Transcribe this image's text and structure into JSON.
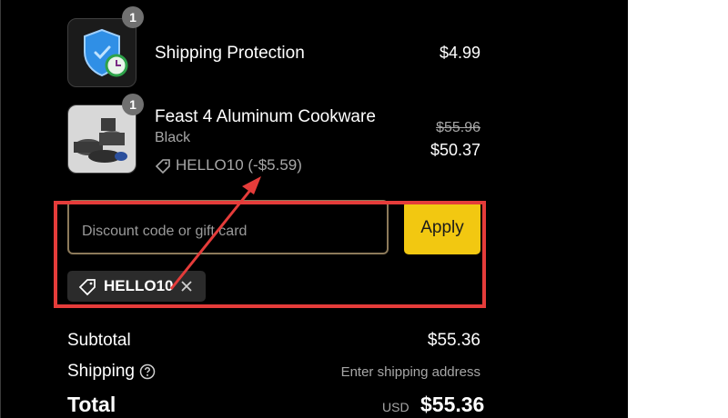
{
  "items": [
    {
      "quantity": "1",
      "name": "Shipping Protection",
      "price": "$4.99",
      "thumbnail_icon": "shield-clock-icon"
    },
    {
      "quantity": "1",
      "name": "Feast 4 Aluminum Cookware",
      "variant": "Black",
      "discount_text": "HELLO10 (-$5.59)",
      "original_price": "$55.96",
      "price": "$50.37",
      "thumbnail_icon": "cookware-set-icon"
    }
  ],
  "discount": {
    "placeholder": "Discount code or gift card",
    "value": "",
    "apply_label": "Apply",
    "applied_code": "HELLO10"
  },
  "summary": {
    "subtotal_label": "Subtotal",
    "subtotal_value": "$55.36",
    "shipping_label": "Shipping",
    "shipping_value": "Enter shipping address",
    "total_label": "Total",
    "currency": "USD",
    "total_value": "$55.36"
  },
  "colors": {
    "background": "#000000",
    "apply_button": "#f2c811",
    "annotation": "#e53c3a",
    "shield": "#2f8fe6"
  }
}
